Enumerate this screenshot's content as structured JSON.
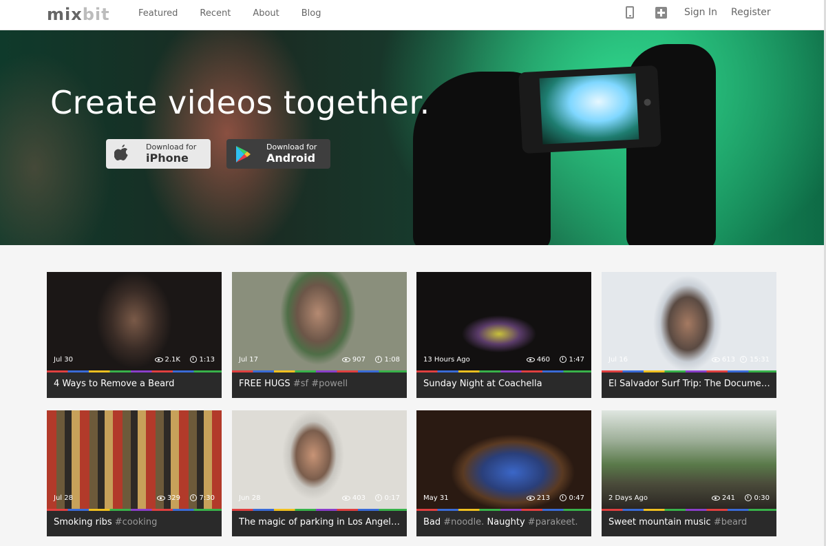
{
  "header": {
    "logo_part1": "mix",
    "logo_part2": "bit",
    "nav": [
      "Featured",
      "Recent",
      "About",
      "Blog"
    ],
    "sign_in": "Sign In",
    "register": "Register",
    "icons": [
      "phone-icon",
      "plus-icon"
    ]
  },
  "hero": {
    "title": "Create videos together.",
    "ios_small": "Download for",
    "ios_big": "iPhone",
    "android_small": "Download for",
    "android_big": "Android"
  },
  "videos": [
    {
      "date": "Jul 30",
      "views": "2.1K",
      "duration": "1:13",
      "title": "4 Ways to Remove a Beard",
      "tags": ""
    },
    {
      "date": "Jul 17",
      "views": "907",
      "duration": "1:08",
      "title": "FREE HUGS",
      "tags": " #sf #powell"
    },
    {
      "date": "13 Hours Ago",
      "views": "460",
      "duration": "1:47",
      "title": "Sunday Night at Coachella",
      "tags": ""
    },
    {
      "date": "Jul 16",
      "views": "613",
      "duration": "15:31",
      "title": "El Salvador Surf Trip: The Document...",
      "tags": ""
    },
    {
      "date": "Jul 28",
      "views": "329",
      "duration": "7:30",
      "title": "Smoking ribs",
      "tags": " #cooking"
    },
    {
      "date": "Jun 28",
      "views": "403",
      "duration": "0:17",
      "title": "The magic of parking in Los Angeles.",
      "tags": ""
    },
    {
      "date": "May 31",
      "views": "213",
      "duration": "0:47",
      "title": "Bad",
      "tags": " #noodle.",
      "title2": " Naughty",
      "tags2": " #parakeet."
    },
    {
      "date": "2 Days Ago",
      "views": "241",
      "duration": "0:30",
      "title": "Sweet mountain music",
      "tags": " #beard"
    }
  ]
}
